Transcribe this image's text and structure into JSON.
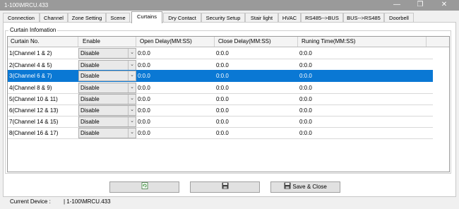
{
  "window": {
    "title": "1-100\\MRCU.433"
  },
  "tabs": [
    "Connection",
    "Channel",
    "Zone Setting",
    "Scene",
    "Curtains",
    "Dry Contact",
    "Security Setup",
    "Stair light",
    "HVAC",
    "RS485-->BUS",
    "BUS-->RS485",
    "Doorbell"
  ],
  "active_tab": "Curtains",
  "group": {
    "label": "Curtain Infomation"
  },
  "table": {
    "columns": [
      "Curtain No.",
      "Enable",
      "Open Delay(MM:SS)",
      "Close Delay(MM:SS)",
      "Runing Time(MM:SS)"
    ],
    "rows": [
      {
        "no": "1(Channel 1 & 2)",
        "enable": "Disable",
        "open": "0:0.0",
        "close": "0:0.0",
        "run": "0:0.0"
      },
      {
        "no": "2(Channel 4 & 5)",
        "enable": "Disable",
        "open": "0:0.0",
        "close": "0:0.0",
        "run": "0:0.0"
      },
      {
        "no": "3(Channel 6 & 7)",
        "enable": "Disable",
        "open": "0:0.0",
        "close": "0:0.0",
        "run": "0:0.0"
      },
      {
        "no": "4(Channel 8 & 9)",
        "enable": "Disable",
        "open": "0:0.0",
        "close": "0:0.0",
        "run": "0:0.0"
      },
      {
        "no": "5(Channel 10 & 11)",
        "enable": "Disable",
        "open": "0:0.0",
        "close": "0:0.0",
        "run": "0:0.0"
      },
      {
        "no": "6(Channel 12 & 13)",
        "enable": "Disable",
        "open": "0:0.0",
        "close": "0:0.0",
        "run": "0:0.0"
      },
      {
        "no": "7(Channel 14 & 15)",
        "enable": "Disable",
        "open": "0:0.0",
        "close": "0:0.0",
        "run": "0:0.0"
      },
      {
        "no": "8(Channel 16 & 17)",
        "enable": "Disable",
        "open": "0:0.0",
        "close": "0:0.0",
        "run": "0:0.0"
      }
    ],
    "selected_row": 3
  },
  "buttons": {
    "refresh_icon": "refresh-icon",
    "save_icon": "floppy-disk-icon",
    "save_close": "Save & Close"
  },
  "status": {
    "label": "Current Device :",
    "value": "| 1-100\\MRCU.433"
  },
  "colors": {
    "selection": "#0a78d4",
    "titlebar": "#9a9a9a"
  }
}
